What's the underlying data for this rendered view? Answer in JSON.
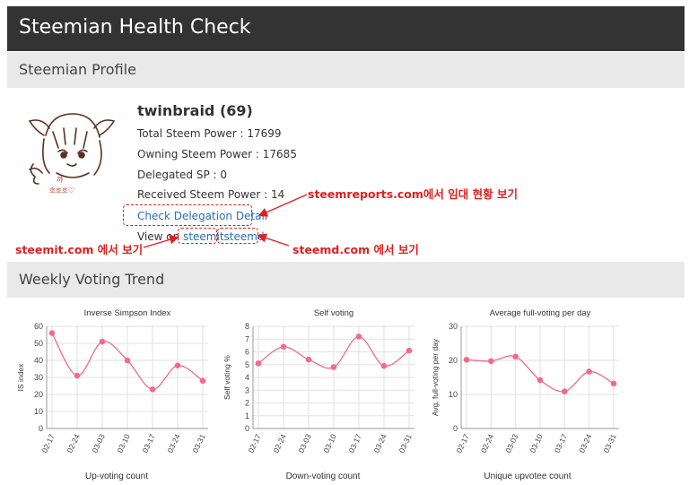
{
  "header": {
    "title": "Steemian Health Check"
  },
  "profile_section": {
    "title": "Steemian Profile"
  },
  "profile": {
    "username": "twinbraid (69)",
    "total_sp": "Total Steem Power : 17699",
    "owning_sp": "Owning Steem Power : 17685",
    "delegated_sp": "Delegated SP : 0",
    "received_sp": "Received Steem Power : 14",
    "delegation_link": "Check Delegation Detail",
    "view_on_label": "View on",
    "steemit_link": "steemit",
    "steemd_link": "steemd"
  },
  "annotations": {
    "steemreports": "steemreports.com에서 임대 현황 보기",
    "steemit": "steemit.com 에서 보기",
    "steemd": "steemd.com 에서 보기",
    "color": "#e02020"
  },
  "avatar_caption": [
    "꺄",
    "흐흐흐♡"
  ],
  "trend_section": {
    "title": "Weekly Voting Trend"
  },
  "accent_color": "#f46a8b",
  "charts": [
    {
      "title": "Inverse Simpson Index",
      "footer": "Up-voting count"
    },
    {
      "title": "Self voting",
      "footer": "Down-voting count"
    },
    {
      "title": "Average full-voting per day",
      "footer": "Unique upvotee count"
    }
  ],
  "chart_data": [
    {
      "type": "line",
      "title": "Inverse Simpson Index",
      "xlabel": "",
      "ylabel": "IS index",
      "categories": [
        "02-17",
        "02-24",
        "03-03",
        "03-10",
        "03-17",
        "03-24",
        "03-31"
      ],
      "values": [
        56,
        31,
        51,
        40,
        23,
        37,
        28
      ],
      "ylim": [
        0,
        60
      ],
      "yticks": [
        0,
        10,
        20,
        30,
        40,
        50,
        60
      ],
      "grid": true,
      "color": "#f46a8b"
    },
    {
      "type": "line",
      "title": "Self voting",
      "xlabel": "",
      "ylabel": "Self voting %",
      "categories": [
        "02-17",
        "02-24",
        "03-03",
        "03-10",
        "03-17",
        "03-24",
        "03-31"
      ],
      "values": [
        5.1,
        6.4,
        5.4,
        4.8,
        7.2,
        4.9,
        6.1
      ],
      "ylim": [
        0,
        8
      ],
      "yticks": [
        0,
        1,
        2,
        3,
        4,
        5,
        6,
        7,
        8
      ],
      "grid": true,
      "color": "#f46a8b"
    },
    {
      "type": "line",
      "title": "Average full-voting per day",
      "xlabel": "",
      "ylabel": "Avg. full-voting per day",
      "categories": [
        "02-17",
        "02-24",
        "03-03",
        "03-10",
        "03-17",
        "03-24",
        "03-31"
      ],
      "values": [
        20.2,
        19.8,
        21.1,
        14.2,
        10.9,
        16.7,
        13.2
      ],
      "ylim": [
        0,
        30
      ],
      "yticks": [
        0,
        10,
        20,
        30
      ],
      "grid": true,
      "color": "#f46a8b"
    }
  ]
}
